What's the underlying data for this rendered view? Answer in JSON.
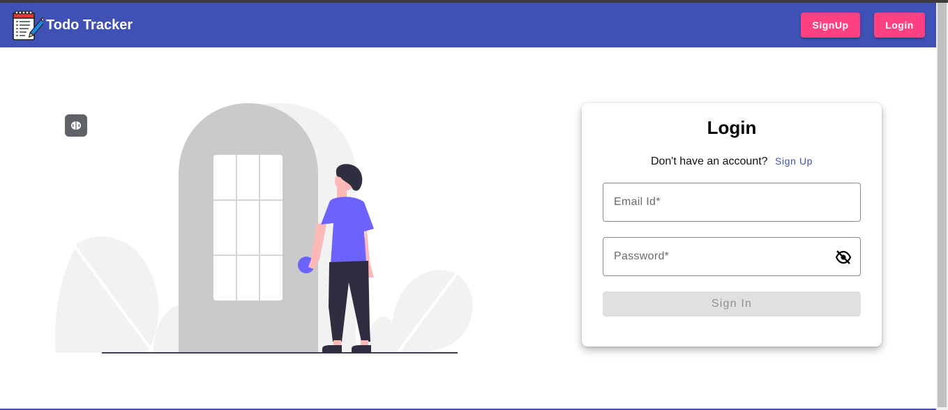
{
  "app": {
    "title": "Todo Tracker",
    "logo_icon": "notepad-pencil-icon"
  },
  "nav": {
    "signup_label": "SignUp",
    "login_label": "Login"
  },
  "login_card": {
    "title": "Login",
    "prompt_text": "Don't have an account?",
    "signup_link": "Sign Up",
    "email": {
      "placeholder": "Email Id*",
      "value": ""
    },
    "password": {
      "placeholder": "Password*",
      "value": "",
      "toggle_icon": "eye-off-icon"
    },
    "submit_label": "Sign In"
  },
  "colors": {
    "primary": "#3f51b5",
    "accent": "#ff4081",
    "figure_shirt": "#6c63ff",
    "door": "#cacaca"
  },
  "icons": {
    "floating_badge": "brain-icon"
  }
}
